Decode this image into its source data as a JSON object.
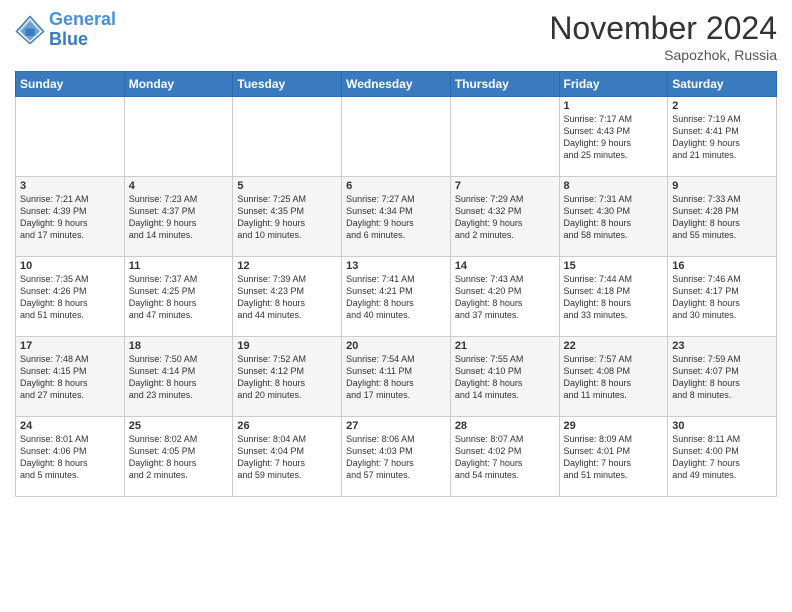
{
  "header": {
    "logo_line1": "General",
    "logo_line2": "Blue",
    "month": "November 2024",
    "location": "Sapozhok, Russia"
  },
  "days_of_week": [
    "Sunday",
    "Monday",
    "Tuesday",
    "Wednesday",
    "Thursday",
    "Friday",
    "Saturday"
  ],
  "weeks": [
    [
      {
        "num": "",
        "info": ""
      },
      {
        "num": "",
        "info": ""
      },
      {
        "num": "",
        "info": ""
      },
      {
        "num": "",
        "info": ""
      },
      {
        "num": "",
        "info": ""
      },
      {
        "num": "1",
        "info": "Sunrise: 7:17 AM\nSunset: 4:43 PM\nDaylight: 9 hours\nand 25 minutes."
      },
      {
        "num": "2",
        "info": "Sunrise: 7:19 AM\nSunset: 4:41 PM\nDaylight: 9 hours\nand 21 minutes."
      }
    ],
    [
      {
        "num": "3",
        "info": "Sunrise: 7:21 AM\nSunset: 4:39 PM\nDaylight: 9 hours\nand 17 minutes."
      },
      {
        "num": "4",
        "info": "Sunrise: 7:23 AM\nSunset: 4:37 PM\nDaylight: 9 hours\nand 14 minutes."
      },
      {
        "num": "5",
        "info": "Sunrise: 7:25 AM\nSunset: 4:35 PM\nDaylight: 9 hours\nand 10 minutes."
      },
      {
        "num": "6",
        "info": "Sunrise: 7:27 AM\nSunset: 4:34 PM\nDaylight: 9 hours\nand 6 minutes."
      },
      {
        "num": "7",
        "info": "Sunrise: 7:29 AM\nSunset: 4:32 PM\nDaylight: 9 hours\nand 2 minutes."
      },
      {
        "num": "8",
        "info": "Sunrise: 7:31 AM\nSunset: 4:30 PM\nDaylight: 8 hours\nand 58 minutes."
      },
      {
        "num": "9",
        "info": "Sunrise: 7:33 AM\nSunset: 4:28 PM\nDaylight: 8 hours\nand 55 minutes."
      }
    ],
    [
      {
        "num": "10",
        "info": "Sunrise: 7:35 AM\nSunset: 4:26 PM\nDaylight: 8 hours\nand 51 minutes."
      },
      {
        "num": "11",
        "info": "Sunrise: 7:37 AM\nSunset: 4:25 PM\nDaylight: 8 hours\nand 47 minutes."
      },
      {
        "num": "12",
        "info": "Sunrise: 7:39 AM\nSunset: 4:23 PM\nDaylight: 8 hours\nand 44 minutes."
      },
      {
        "num": "13",
        "info": "Sunrise: 7:41 AM\nSunset: 4:21 PM\nDaylight: 8 hours\nand 40 minutes."
      },
      {
        "num": "14",
        "info": "Sunrise: 7:43 AM\nSunset: 4:20 PM\nDaylight: 8 hours\nand 37 minutes."
      },
      {
        "num": "15",
        "info": "Sunrise: 7:44 AM\nSunset: 4:18 PM\nDaylight: 8 hours\nand 33 minutes."
      },
      {
        "num": "16",
        "info": "Sunrise: 7:46 AM\nSunset: 4:17 PM\nDaylight: 8 hours\nand 30 minutes."
      }
    ],
    [
      {
        "num": "17",
        "info": "Sunrise: 7:48 AM\nSunset: 4:15 PM\nDaylight: 8 hours\nand 27 minutes."
      },
      {
        "num": "18",
        "info": "Sunrise: 7:50 AM\nSunset: 4:14 PM\nDaylight: 8 hours\nand 23 minutes."
      },
      {
        "num": "19",
        "info": "Sunrise: 7:52 AM\nSunset: 4:12 PM\nDaylight: 8 hours\nand 20 minutes."
      },
      {
        "num": "20",
        "info": "Sunrise: 7:54 AM\nSunset: 4:11 PM\nDaylight: 8 hours\nand 17 minutes."
      },
      {
        "num": "21",
        "info": "Sunrise: 7:55 AM\nSunset: 4:10 PM\nDaylight: 8 hours\nand 14 minutes."
      },
      {
        "num": "22",
        "info": "Sunrise: 7:57 AM\nSunset: 4:08 PM\nDaylight: 8 hours\nand 11 minutes."
      },
      {
        "num": "23",
        "info": "Sunrise: 7:59 AM\nSunset: 4:07 PM\nDaylight: 8 hours\nand 8 minutes."
      }
    ],
    [
      {
        "num": "24",
        "info": "Sunrise: 8:01 AM\nSunset: 4:06 PM\nDaylight: 8 hours\nand 5 minutes."
      },
      {
        "num": "25",
        "info": "Sunrise: 8:02 AM\nSunset: 4:05 PM\nDaylight: 8 hours\nand 2 minutes."
      },
      {
        "num": "26",
        "info": "Sunrise: 8:04 AM\nSunset: 4:04 PM\nDaylight: 7 hours\nand 59 minutes."
      },
      {
        "num": "27",
        "info": "Sunrise: 8:06 AM\nSunset: 4:03 PM\nDaylight: 7 hours\nand 57 minutes."
      },
      {
        "num": "28",
        "info": "Sunrise: 8:07 AM\nSunset: 4:02 PM\nDaylight: 7 hours\nand 54 minutes."
      },
      {
        "num": "29",
        "info": "Sunrise: 8:09 AM\nSunset: 4:01 PM\nDaylight: 7 hours\nand 51 minutes."
      },
      {
        "num": "30",
        "info": "Sunrise: 8:11 AM\nSunset: 4:00 PM\nDaylight: 7 hours\nand 49 minutes."
      }
    ]
  ]
}
